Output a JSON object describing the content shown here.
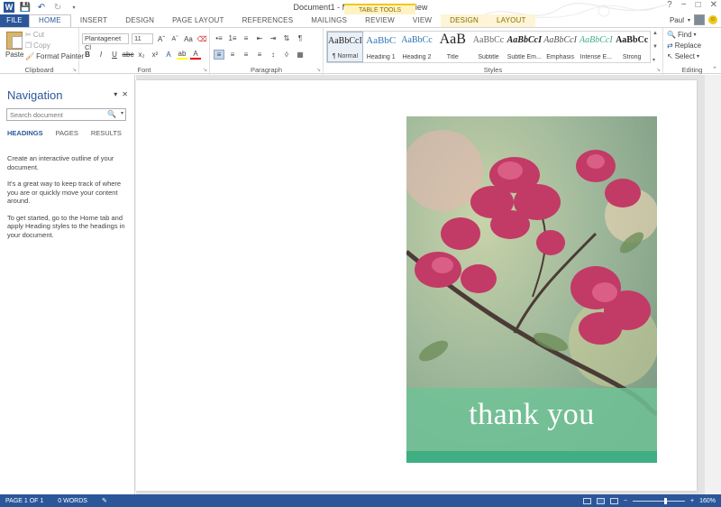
{
  "window": {
    "title": "Document1 - Microsoft Word Preview",
    "controls": [
      "?",
      "−",
      "□",
      "✕"
    ]
  },
  "tabs": {
    "file": "FILE",
    "home": "HOME",
    "insert": "INSERT",
    "design": "DESIGN",
    "page_layout": "PAGE LAYOUT",
    "references": "REFERENCES",
    "mailings": "MAILINGS",
    "review": "REVIEW",
    "view": "VIEW",
    "table_tools": "TABLE TOOLS",
    "tt_design": "DESIGN",
    "tt_layout": "LAYOUT"
  },
  "user": {
    "name": "Paul"
  },
  "ribbon": {
    "clipboard": {
      "label": "Clipboard",
      "paste": "Paste",
      "cut": "Cut",
      "copy": "Copy",
      "format_painter": "Format Painter"
    },
    "font": {
      "label": "Font",
      "font_name": "Plantagenet Cl",
      "font_size": "11"
    },
    "paragraph": {
      "label": "Paragraph"
    },
    "styles": {
      "label": "Styles",
      "items": [
        {
          "sample": "AaBbCcI",
          "name": "¶ Normal"
        },
        {
          "sample": "AaBbC",
          "name": "Heading 1"
        },
        {
          "sample": "AaBbCc",
          "name": "Heading 2"
        },
        {
          "sample": "AaB",
          "name": "Title"
        },
        {
          "sample": "AaBbCc",
          "name": "Subtitle"
        },
        {
          "sample": "AaBbCcI",
          "name": "Subtle Em..."
        },
        {
          "sample": "AaBbCcI",
          "name": "Emphasis"
        },
        {
          "sample": "AaBbCcI",
          "name": "Intense E..."
        },
        {
          "sample": "AaBbCc",
          "name": "Strong"
        }
      ]
    },
    "editing": {
      "label": "Editing",
      "find": "Find",
      "replace": "Replace",
      "select": "Select"
    }
  },
  "navigation": {
    "title": "Navigation",
    "search_placeholder": "Search document",
    "tabs": [
      "HEADINGS",
      "PAGES",
      "RESULTS"
    ],
    "messages": [
      "Create an interactive outline of your document.",
      "It's a great way to keep track of where you are or quickly move your content around.",
      "To get started, go to the Home tab and apply Heading styles to the headings in your document."
    ]
  },
  "document": {
    "card_text": "thank you"
  },
  "status": {
    "page": "PAGE 1 OF 1",
    "words": "0 WORDS",
    "zoom": "160%",
    "zoom_level_fraction": 0.6
  },
  "colors": {
    "accent": "#2b579a",
    "card_band": "#70c296",
    "card_strip": "#3fae82"
  }
}
